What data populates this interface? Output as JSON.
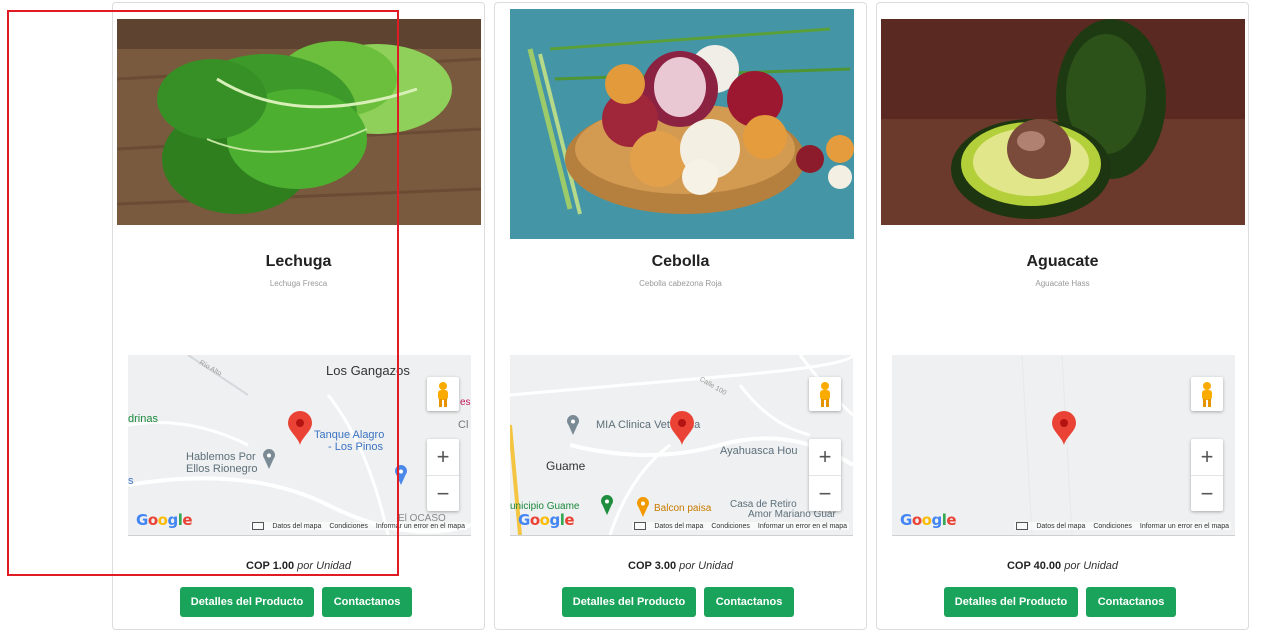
{
  "products": [
    {
      "name": "Lechuga",
      "description": "Lechuga Fresca",
      "image_icon": "lettuce-photo",
      "price": "COP 1.00",
      "unit": "por Unidad",
      "details_label": "Detalles del Producto",
      "contact_label": "Contactanos",
      "map": {
        "labels": [
          "Los Gangazos",
          "drinas",
          "Tanque Alagro",
          "- Los Pinos",
          "Hablemos Por",
          "Ellos Rionegro",
          "Cl",
          "es",
          "s",
          "El OCASO"
        ],
        "road_label": "Río Alto",
        "google": "Google",
        "footer": [
          "Datos del mapa",
          "Condiciones",
          "Informar un error en el mapa"
        ]
      }
    },
    {
      "name": "Cebolla",
      "description": "Cebolla cabezona Roja",
      "image_icon": "onion-photo",
      "price": "COP 3.00",
      "unit": "por Unidad",
      "details_label": "Detalles del Producto",
      "contact_label": "Contactanos",
      "map": {
        "labels": [
          "MIA Clinica Vete",
          "ria",
          "Guame",
          "Ayahuasca Hou",
          "unicipio Guame",
          "Balcon paisa",
          "Casa de Retiro",
          "Amor Mariano Guar"
        ],
        "road_label": "Calle 100",
        "google": "Google",
        "footer": [
          "Datos del mapa",
          "Condiciones",
          "Informar un error en el mapa"
        ]
      }
    },
    {
      "name": "Aguacate",
      "description": "Aguacate Hass",
      "image_icon": "avocado-photo",
      "price": "COP 40.00",
      "unit": "por Unidad",
      "details_label": "Detalles del Producto",
      "contact_label": "Contactanos",
      "map": {
        "labels": [],
        "road_label": "",
        "google": "Google",
        "footer": [
          "Datos del mapa",
          "Condiciones",
          "Informar un error en el mapa"
        ]
      }
    }
  ],
  "colors": {
    "button_green": "#1aa35a",
    "marker_red": "#ea4335",
    "highlight_red": "#e01b24"
  }
}
